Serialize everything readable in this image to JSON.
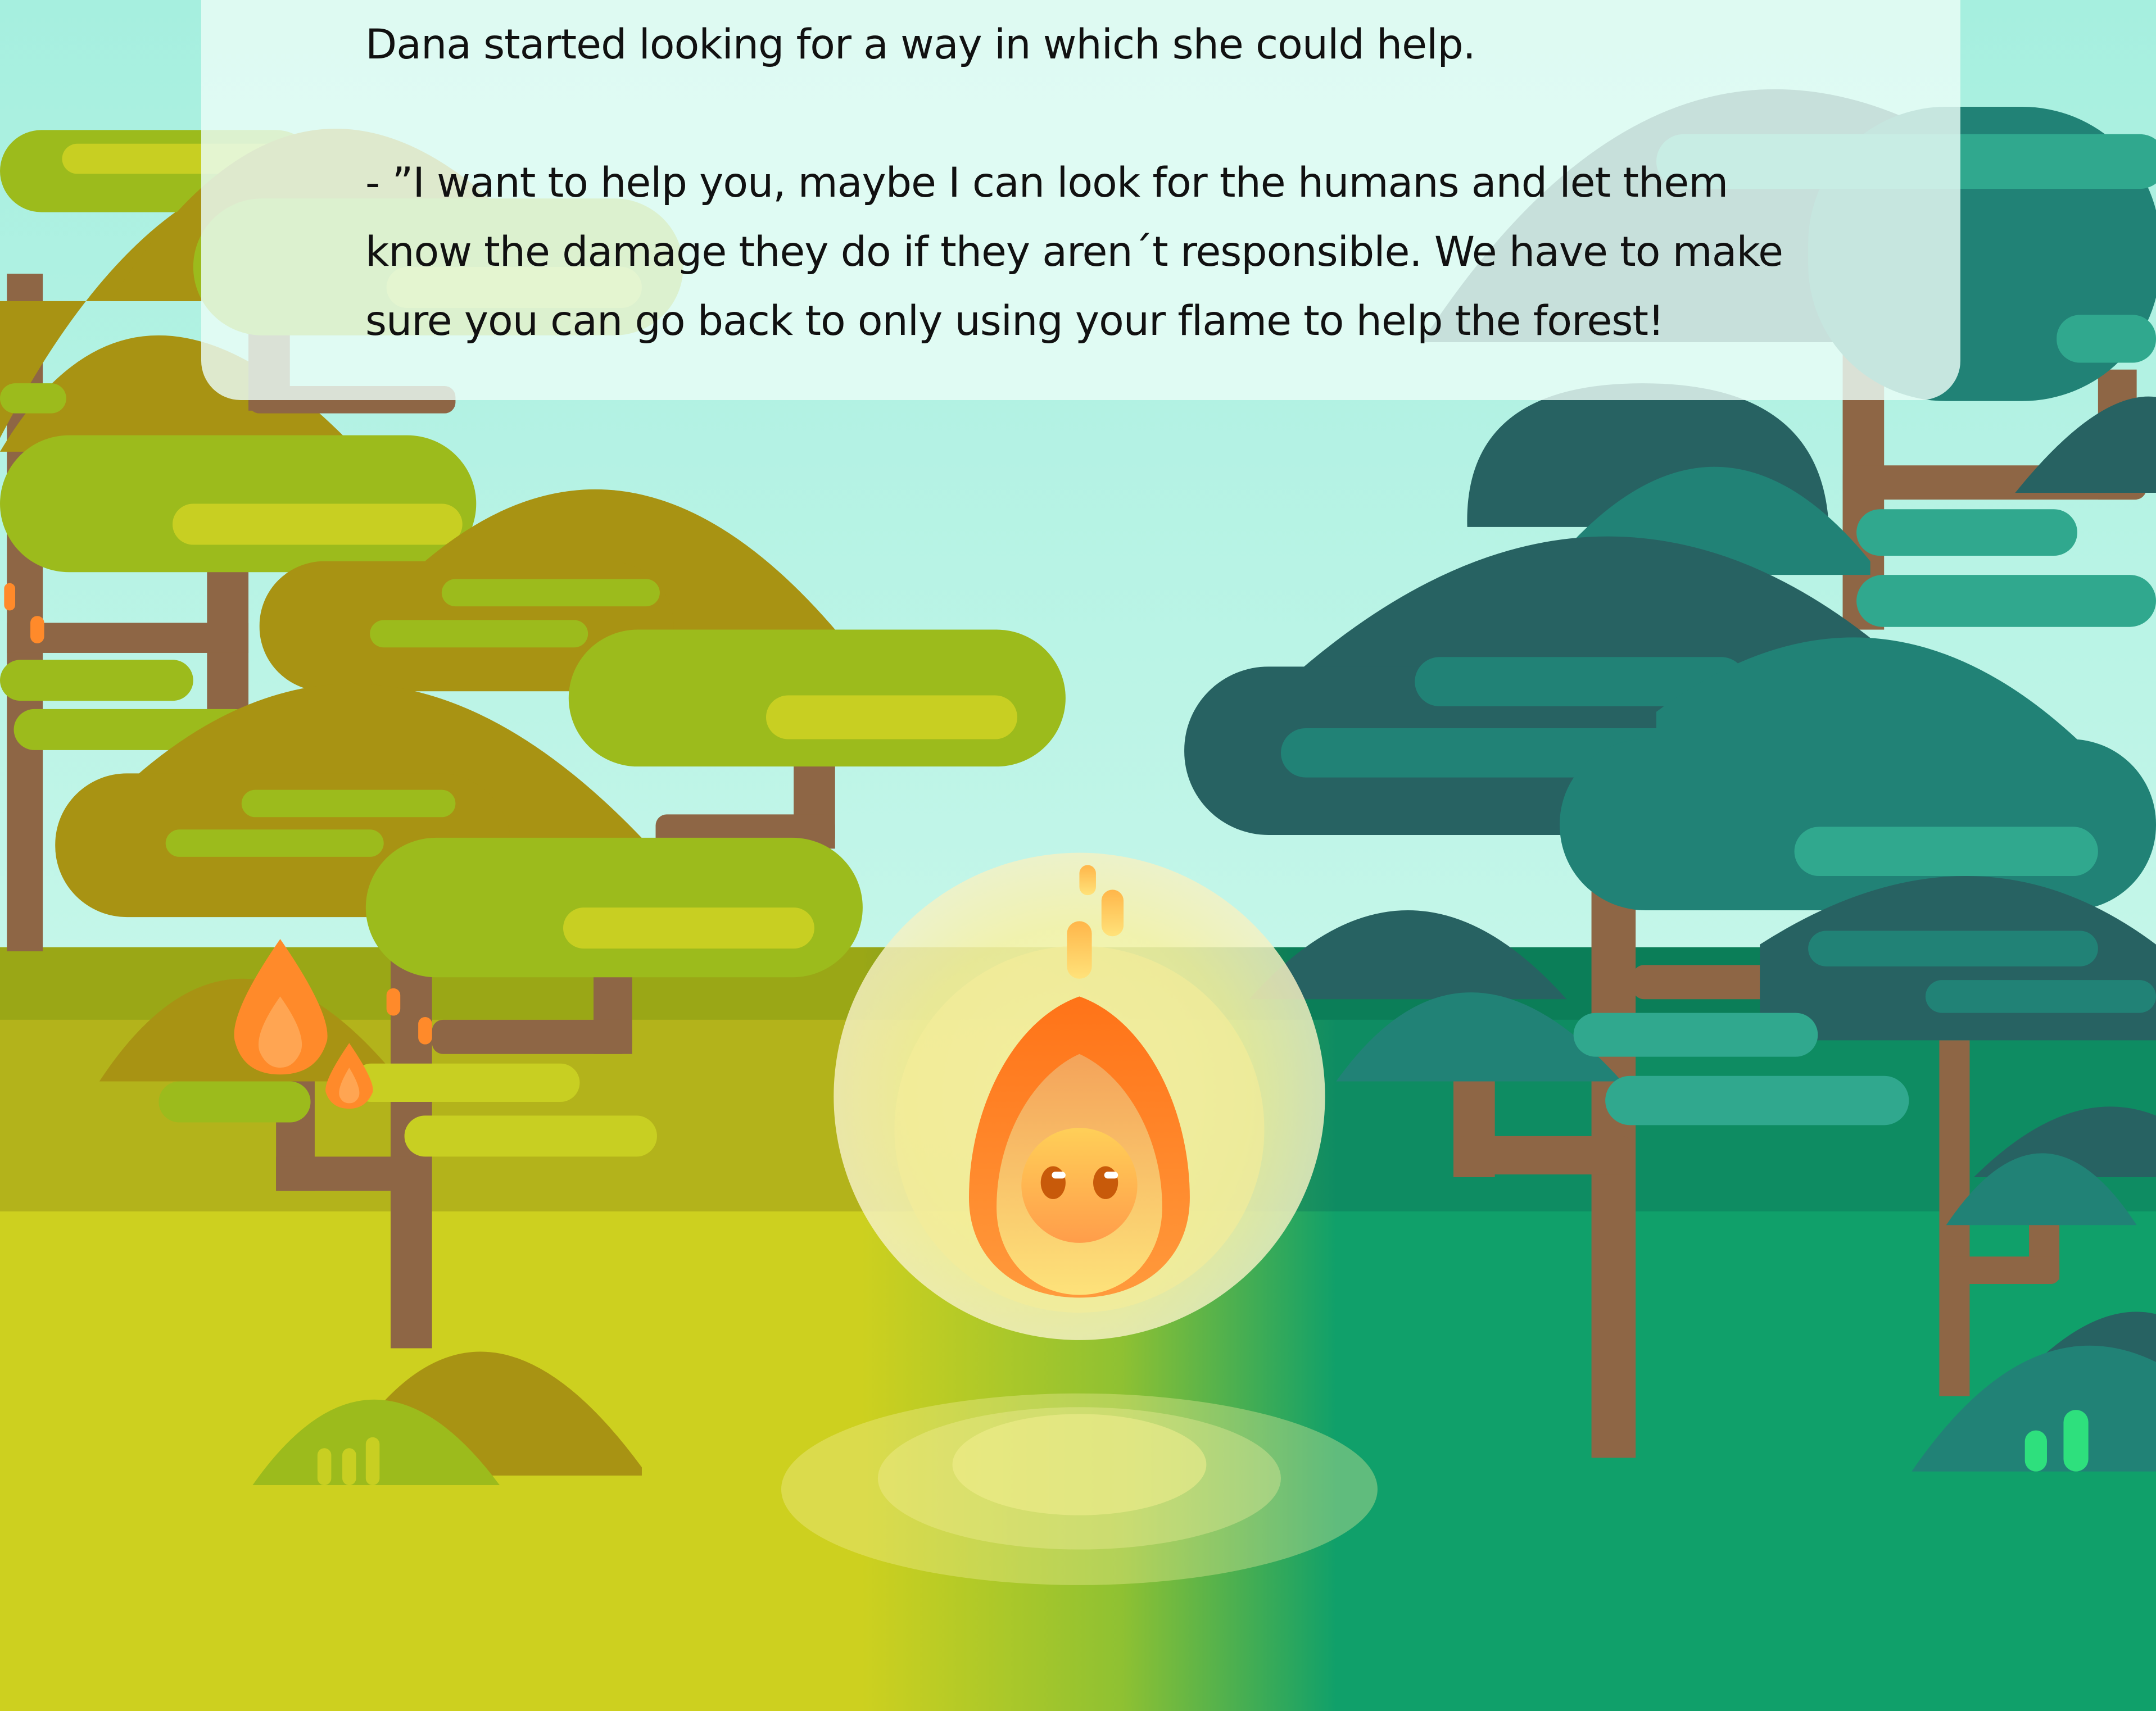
{
  "story": {
    "narration": "Dana started looking for a way in which she could help.",
    "dialogue_line_1": "- ”I want to help you, maybe I can look for the humans and let them",
    "dialogue_line_2": "know the damage they do if they aren´t responsible. We have to make",
    "dialogue_line_3": "sure you can go back to only using your flame to help the forest!"
  },
  "scene": {
    "character": "flame-spirit",
    "character_icon": "flame-spirit-icon",
    "left_side": "burning-forest",
    "right_side": "healthy-forest",
    "colors": {
      "sky": "#aef2e2",
      "burning_ground": "#cdd01f",
      "healthy_ground": "#0f9e6a",
      "burning_canopy": "#a89313",
      "burning_foliage": "#9cbb1c",
      "healthy_canopy": "#276262",
      "healthy_foliage": "#218276",
      "trunk": "#8e6645",
      "flame_outer": "#ff7a1e",
      "flame_inner": "#fdd36a",
      "glow": "#f7f4bf"
    }
  }
}
